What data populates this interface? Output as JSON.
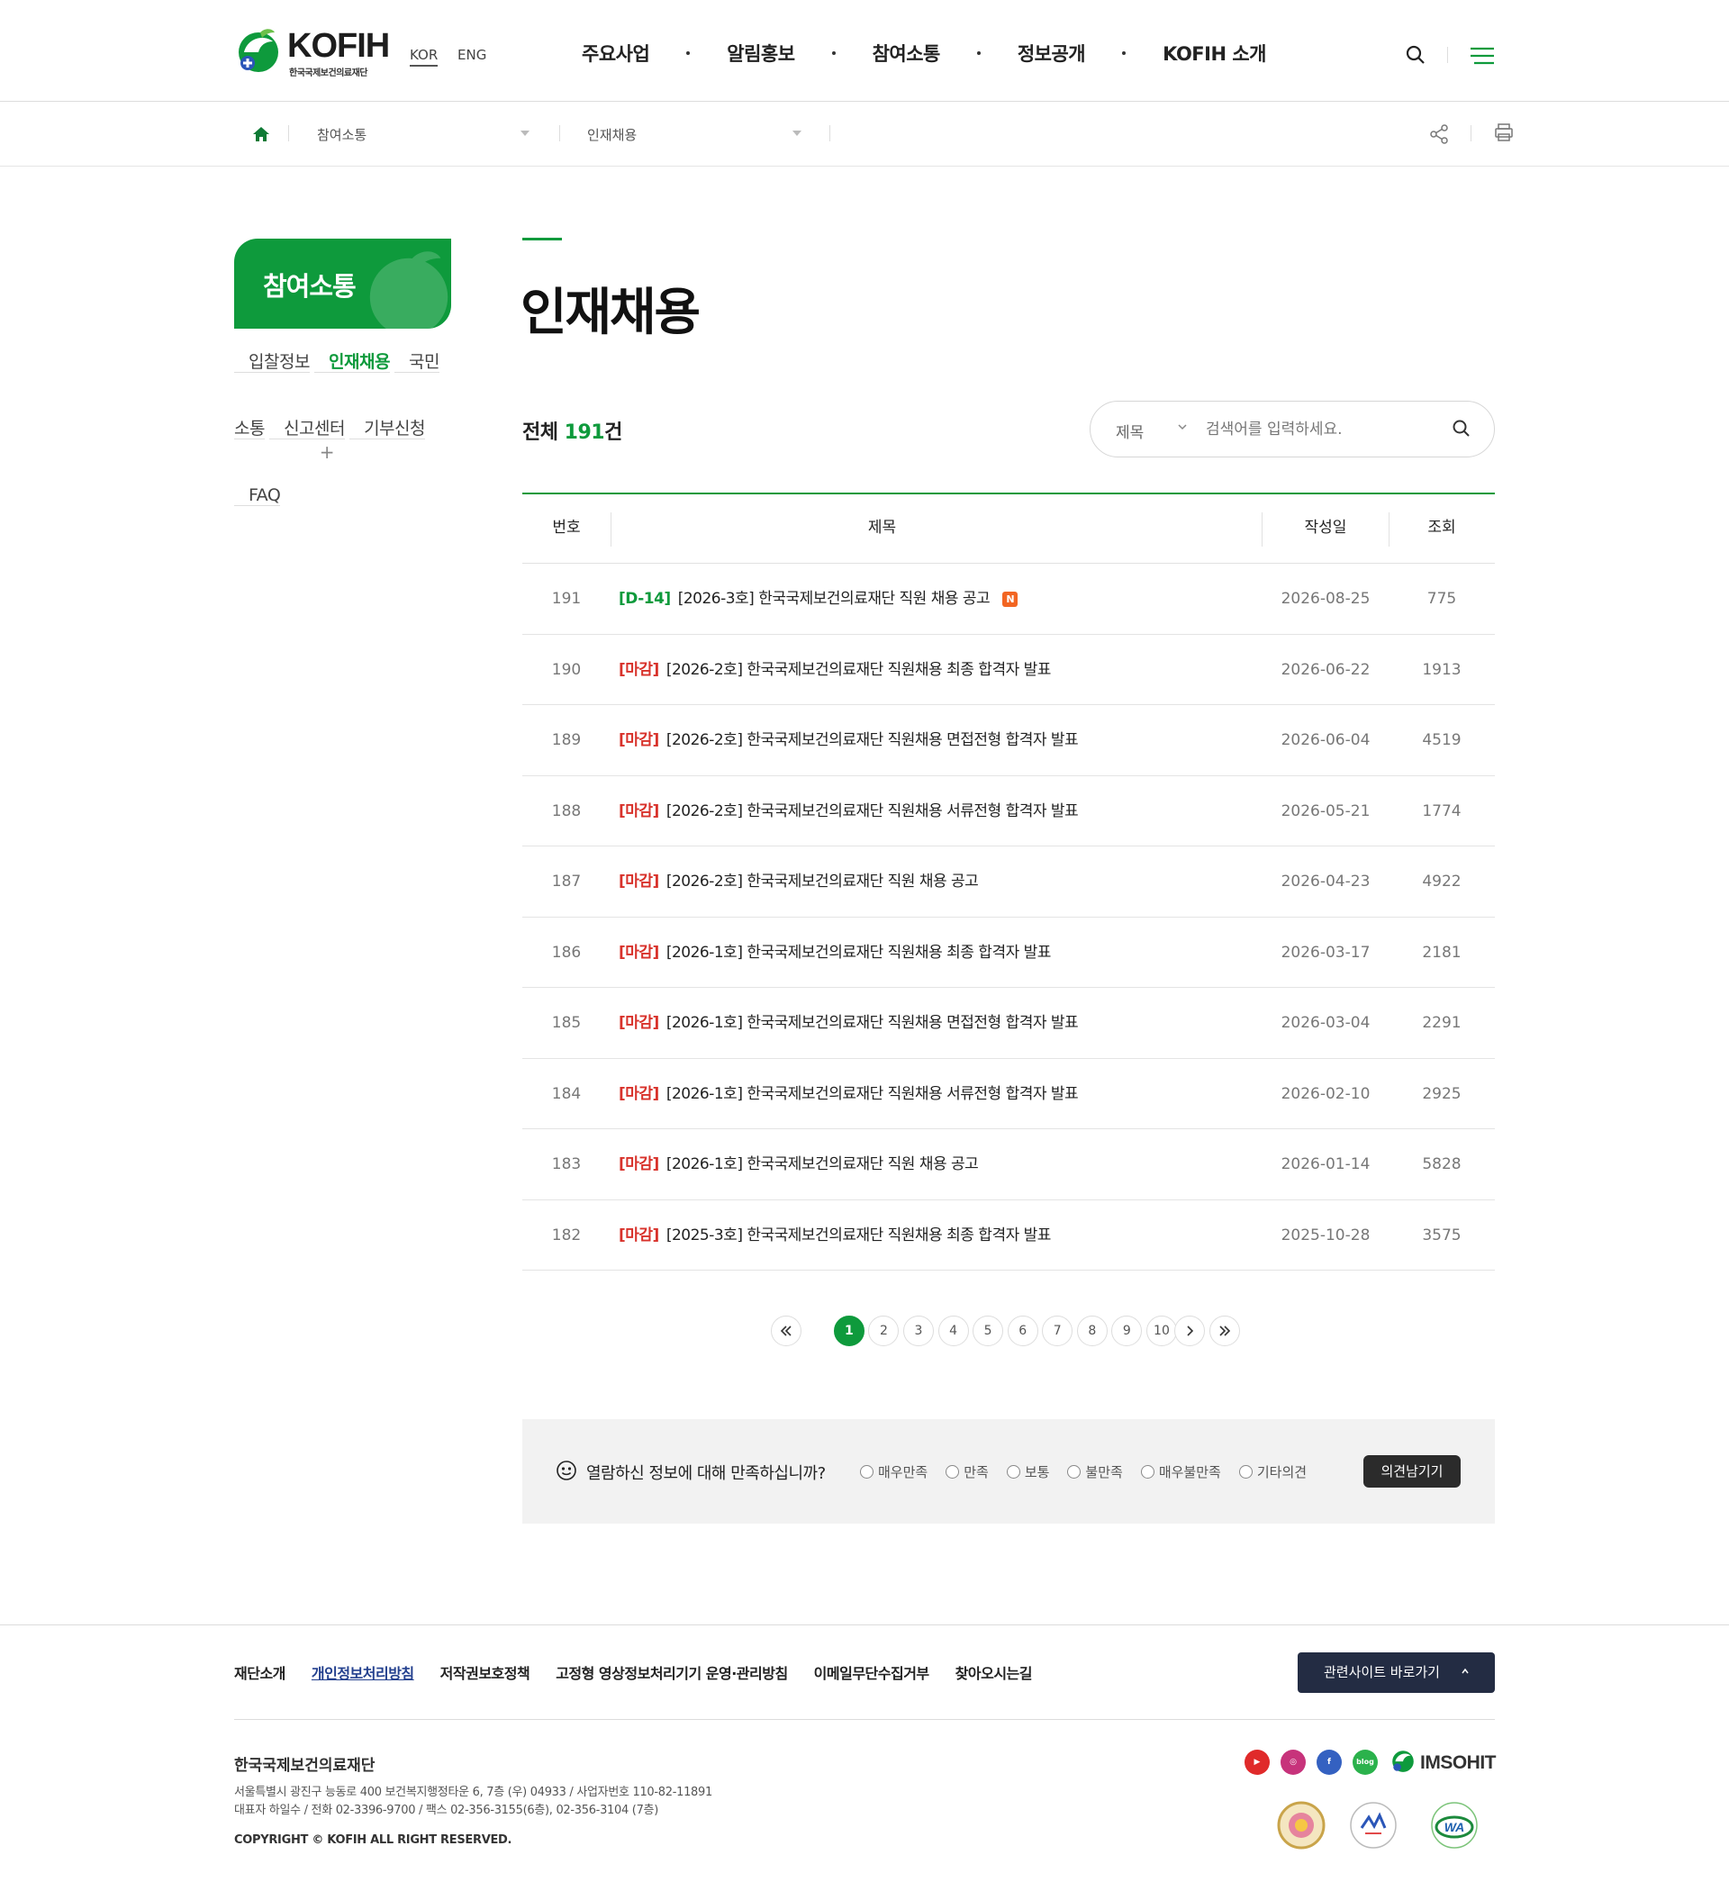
{
  "header": {
    "logo_text": "KOFIH",
    "logo_sub": "한국국제보건의료재단",
    "lang_kor": "KOR",
    "lang_eng": "ENG",
    "gnb": [
      "주요사업",
      "알림홍보",
      "참여소통",
      "정보공개",
      "KOFIH 소개"
    ],
    "icons": [
      "search-icon",
      "hamburger-menu-icon"
    ]
  },
  "location": {
    "depth1": "참여소통",
    "depth2": "인재채용",
    "icons": [
      "home-icon",
      "share-icon",
      "print-icon"
    ]
  },
  "lnb": {
    "title": "참여소통",
    "items": [
      {
        "label": "입찰정보"
      },
      {
        "label": "인재채용",
        "active": true
      },
      {
        "label": "국민 소통"
      },
      {
        "label": "신고센터",
        "expandable": true,
        "expand_symbol": "+"
      },
      {
        "label": "기부신청"
      },
      {
        "label": "FAQ"
      }
    ]
  },
  "content": {
    "page_title": "인재채용",
    "total_prefix": "전체 ",
    "total_count": "191",
    "total_suffix": "건",
    "search": {
      "select_value": "제목",
      "placeholder": "검색어를 입력하세요."
    },
    "columns": [
      "번호",
      "제목",
      "작성일",
      "조회"
    ],
    "rows": [
      {
        "no": "191",
        "tag": "[D-14]",
        "tag_color": "#0e9a3c",
        "title": "[2026-3호] 한국국제보건의료재단 직원 채용 공고",
        "new": "N",
        "date": "2026-08-25",
        "views": "775"
      },
      {
        "no": "190",
        "tag": "[마감]",
        "tag_color": "#d8322b",
        "title": "[2026-2호] 한국국제보건의료재단 직원채용 최종 합격자 발표",
        "date": "2026-06-22",
        "views": "1913"
      },
      {
        "no": "189",
        "tag": "[마감]",
        "tag_color": "#d8322b",
        "title": "[2026-2호] 한국국제보건의료재단 직원채용 면접전형 합격자 발표",
        "date": "2026-06-04",
        "views": "4519"
      },
      {
        "no": "188",
        "tag": "[마감]",
        "tag_color": "#d8322b",
        "title": "[2026-2호] 한국국제보건의료재단 직원채용 서류전형 합격자 발표",
        "date": "2026-05-21",
        "views": "1774"
      },
      {
        "no": "187",
        "tag": "[마감]",
        "tag_color": "#d8322b",
        "title": "[2026-2호] 한국국제보건의료재단 직원 채용 공고",
        "date": "2026-04-23",
        "views": "4922"
      },
      {
        "no": "186",
        "tag": "[마감]",
        "tag_color": "#d8322b",
        "title": "[2026-1호] 한국국제보건의료재단 직원채용 최종 합격자 발표",
        "date": "2026-03-17",
        "views": "2181"
      },
      {
        "no": "185",
        "tag": "[마감]",
        "tag_color": "#d8322b",
        "title": "[2026-1호] 한국국제보건의료재단 직원채용 면접전형 합격자 발표",
        "date": "2026-03-04",
        "views": "2291"
      },
      {
        "no": "184",
        "tag": "[마감]",
        "tag_color": "#d8322b",
        "title": "[2026-1호] 한국국제보건의료재단 직원채용 서류전형 합격자 발표",
        "date": "2026-02-10",
        "views": "2925"
      },
      {
        "no": "183",
        "tag": "[마감]",
        "tag_color": "#d8322b",
        "title": "[2026-1호] 한국국제보건의료재단 직원 채용 공고",
        "date": "2026-01-14",
        "views": "5828"
      },
      {
        "no": "182",
        "tag": "[마감]",
        "tag_color": "#d8322b",
        "title": "[2025-3호] 한국국제보건의료재단 직원채용 최종 합격자 발표",
        "date": "2025-10-28",
        "views": "3575"
      }
    ],
    "pagination": {
      "current": "1",
      "pages": [
        "1",
        "2",
        "3",
        "4",
        "5",
        "6",
        "7",
        "8",
        "9",
        "10"
      ],
      "icons": [
        "first-page-icon",
        "next-page-icon",
        "last-page-icon"
      ]
    }
  },
  "survey": {
    "question": "열람하신 정보에 대해 만족하십니까?",
    "options": [
      "매우만족",
      "만족",
      "보통",
      "불만족",
      "매우불만족",
      "기타의견"
    ],
    "submit_label": "의견남기기"
  },
  "footer": {
    "links": [
      {
        "label": "재단소개"
      },
      {
        "label": "개인정보처리방침",
        "emphasis": true
      },
      {
        "label": "저작권보호정책"
      },
      {
        "label": "고정형 영상정보처리기기 운영·관리방침"
      },
      {
        "label": "이메일무단수집거부"
      },
      {
        "label": "찾아오시는길"
      }
    ],
    "family_site": "관련사이트 바로가기",
    "org_name": "한국국제보건의료재단",
    "address_line1": "서울특별시 광진구 능동로 400 보건복지행정타운 6, 7층 (우) 04933 / 사업자번호 110-82-11891",
    "address_line2": "대표자 하일수 / 전화 02-3396-9700 / 팩스 02-356-3155(6층), 02-356-3104 (7층)",
    "copyright": "COPYRIGHT © KOFIH ALL RIGHT RESERVED.",
    "sns": [
      {
        "name": "youtube-icon",
        "color": "#e02a2a",
        "glyph": "▶"
      },
      {
        "name": "instagram-icon",
        "color": "#c7337b",
        "glyph": "◎"
      },
      {
        "name": "facebook-icon",
        "color": "#3461c1",
        "glyph": "f"
      },
      {
        "name": "blog-icon",
        "color": "#2bb24c",
        "glyph": "blog"
      }
    ],
    "imsohit": "IMSOHIT"
  },
  "colors": {
    "brand_green": "#0e9a3c",
    "closed_red": "#d8322b",
    "new_badge": "#f26522",
    "family_btn": "#232c43"
  }
}
